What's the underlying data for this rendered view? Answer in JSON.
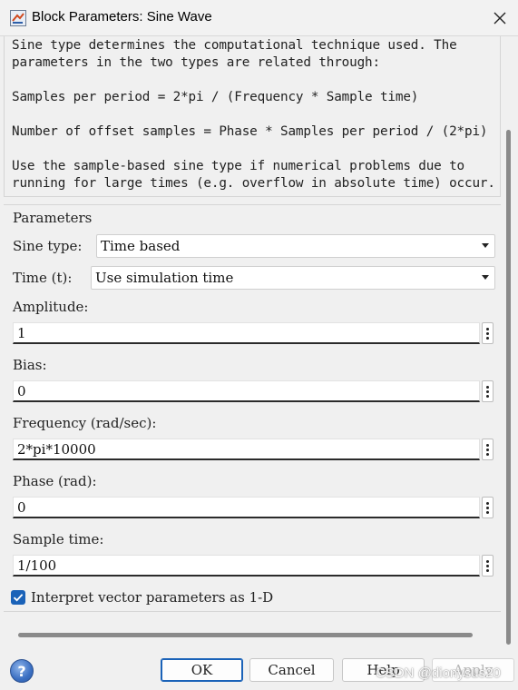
{
  "window": {
    "title": "Block Parameters: Sine Wave",
    "close_icon": "close-icon",
    "app_icon": "simulink-block-icon"
  },
  "description": {
    "lines": [
      "Sine type determines the computational technique used. The",
      "parameters in the two types are related through:",
      "Samples per period = 2*pi / (Frequency * Sample time)",
      "Number of offset samples = Phase * Samples per period / (2*pi)",
      "Use the sample-based sine type if numerical problems due to",
      "running for large times (e.g. overflow in absolute time) occur."
    ]
  },
  "parameters": {
    "group_title": "Parameters",
    "sine_type": {
      "label": "Sine type:",
      "value": "Time based"
    },
    "time": {
      "label": "Time (t):",
      "value": "Use simulation time"
    },
    "amplitude": {
      "label": "Amplitude:",
      "value": "1"
    },
    "bias": {
      "label": "Bias:",
      "value": "0"
    },
    "frequency": {
      "label": "Frequency (rad/sec):",
      "value": "2*pi*10000"
    },
    "phase": {
      "label": "Phase (rad):",
      "value": "0"
    },
    "sample_time": {
      "label": "Sample time:",
      "value": "1/100"
    },
    "interpret_vector": {
      "label": "Interpret vector parameters as 1-D",
      "checked": true
    }
  },
  "footer": {
    "help_icon": "help-icon",
    "ok_label": "OK",
    "cancel_label": "Cancel",
    "help_label": "Help",
    "apply_label": "Apply",
    "watermark": "CSDN @dionysus20"
  },
  "colors": {
    "accent": "#1a62b8",
    "background": "#f0f0f0",
    "field_background": "#ffffff",
    "disabled_text": "#b7b7b7"
  }
}
